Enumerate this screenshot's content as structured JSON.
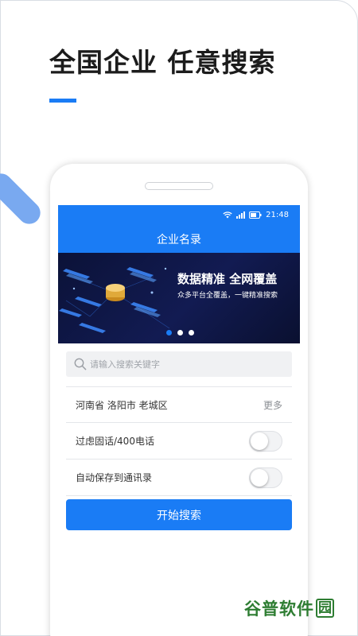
{
  "promo": {
    "headline": "全国企业 任意搜索"
  },
  "statusbar": {
    "time": "21:48",
    "icons": [
      "wifi-icon",
      "signal-icon",
      "battery-icon"
    ]
  },
  "app": {
    "title": "企业名录",
    "banner": {
      "headline": "数据精准 全网覆盖",
      "subline": "众多平台全覆盖，一键精准搜索",
      "carousel_total": 3,
      "carousel_active": 1
    },
    "search": {
      "placeholder": "请输入搜索关键字",
      "value": ""
    },
    "region": {
      "value": "河南省 洛阳市 老城区",
      "more_label": "更多"
    },
    "filters": [
      {
        "label": "过虑固话/400电话",
        "enabled": false
      },
      {
        "label": "自动保存到通讯录",
        "enabled": false
      }
    ],
    "start_button_label": "开始搜索"
  },
  "watermark": {
    "text": "谷普软件",
    "last_char": "园"
  },
  "colors": {
    "accent": "#1a7cf5",
    "banner_bg": "#0b1238",
    "watermark_green": "#2e7d32"
  }
}
